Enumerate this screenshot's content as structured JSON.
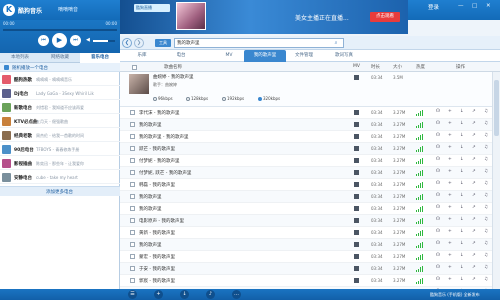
{
  "app": {
    "name": "酷狗音乐",
    "now_playing": "嘀嘀嘀音"
  },
  "banner": {
    "small_text": "酷狗直播",
    "text": "美女主播正在直播...",
    "button": "点击观看"
  },
  "window": {
    "buttons": [
      "登录",
      "—",
      "□",
      "✕"
    ]
  },
  "player": {
    "time_left": "00:00",
    "time_right": "00:00",
    "progress": 0.0,
    "volume": 0.7
  },
  "left_tabs": [
    "本地列表",
    "网络收藏",
    "音乐电台"
  ],
  "active_left_tab": 2,
  "random_radio": "随机播放一个电台",
  "stations": [
    {
      "name": "酷狗热歌",
      "song": "嘀嘀嘀 - 嘀嘀嘀音乐",
      "color": "#e45b6c"
    },
    {
      "name": "Dj电台",
      "song": "Lady GaGa - 3Sexy Whiril Lik",
      "color": "#5a5f8c"
    },
    {
      "name": "新歌电台",
      "song": "刘惜君 - 我知道不应该再爱",
      "color": "#6ba35a"
    },
    {
      "name": "KTV必点曲",
      "song": "五月天 - 倔强歌曲",
      "color": "#c8803b"
    },
    {
      "name": "经典老歌",
      "song": "周杰伦 - 给我一首歌的时间",
      "color": "#8b6d4f"
    },
    {
      "name": "90后电台",
      "song": "TFBOYS - 青春修炼手册",
      "color": "#4b90c9"
    },
    {
      "name": "影视插曲",
      "song": "陈奕迅 - 那些年 - 让我爱你",
      "color": "#b54f8b"
    },
    {
      "name": "安静电台",
      "song": "cube - take my heart",
      "color": "#7a8f9c"
    }
  ],
  "add_station": "添加更多电台",
  "nav": {
    "tool": "工具",
    "search_value": "我的歌声里",
    "search_icon": "search-icon"
  },
  "categories": [
    "乐库",
    "电台",
    "MV",
    "我的歌声里",
    "文件管理",
    "歌词写真"
  ],
  "active_category": 3,
  "table_headers": {
    "title": "歌曲名称",
    "mv": "MV",
    "duration": "时长",
    "size": "大小",
    "heat": "热度",
    "actions": "操作"
  },
  "detail": {
    "title": "曲婉婷 - 我的歌声里",
    "singer": "歌手：曲婉婷",
    "qualities": [
      "96kbps",
      "128kbps",
      "192kbps",
      "320kbps"
    ],
    "selected_quality": 3,
    "duration": "03:34",
    "size": "3.5M"
  },
  "songs": [
    {
      "title": "李代沫 - 我的歌声里",
      "duration": "03:34",
      "size": "3.27M",
      "heat": 4
    },
    {
      "title": "我的歌声里",
      "duration": "03:34",
      "size": "3.27M",
      "heat": 4
    },
    {
      "title": "我的歌声里 - 我的歌声里",
      "duration": "03:34",
      "size": "3.27M",
      "heat": 4
    },
    {
      "title": "跃芒 - 我的歌声里",
      "duration": "03:34",
      "size": "3.27M",
      "heat": 4
    },
    {
      "title": "付梦妮 - 我的歌声里",
      "duration": "03:34",
      "size": "3.27M",
      "heat": 4
    },
    {
      "title": "付梦妮, 跃芒 - 我的歌声里",
      "duration": "03:34",
      "size": "3.27M",
      "heat": 4
    },
    {
      "title": "韩磊 - 我的歌声里",
      "duration": "03:34",
      "size": "3.27M",
      "heat": 4
    },
    {
      "title": "我的歌声里",
      "duration": "03:34",
      "size": "3.27M",
      "heat": 4
    },
    {
      "title": "我的歌声里",
      "duration": "03:34",
      "size": "3.27M",
      "heat": 4
    },
    {
      "title": "电影原声 - 我的歌声里",
      "duration": "03:34",
      "size": "3.27M",
      "heat": 4
    },
    {
      "title": "黄新 - 我的歌声里",
      "duration": "03:34",
      "size": "3.27M",
      "heat": 4
    },
    {
      "title": "我的歌声里",
      "duration": "03:34",
      "size": "3.27M",
      "heat": 4
    },
    {
      "title": "蒙宏 - 我的歌声里",
      "duration": "03:34",
      "size": "3.27M",
      "heat": 4
    },
    {
      "title": "于安 - 我的歌声里",
      "duration": "03:34",
      "size": "3.27M",
      "heat": 4
    },
    {
      "title": "郭宸 - 我的歌声里",
      "duration": "03:34",
      "size": "3.27M",
      "heat": 4
    },
    {
      "title": "阿木 - 我的歌声里",
      "duration": "03:34",
      "size": "3.27M",
      "heat": 4
    },
    {
      "title": "我的歌声里",
      "duration": "03:34",
      "size": "3.27M",
      "heat": 4
    }
  ],
  "row_action_icons": [
    "headphones-icon",
    "plus-icon",
    "download-icon",
    "share-icon",
    "bell-icon"
  ],
  "bottom": {
    "brand": "酷狗音乐 (手机版) 全新发布"
  }
}
